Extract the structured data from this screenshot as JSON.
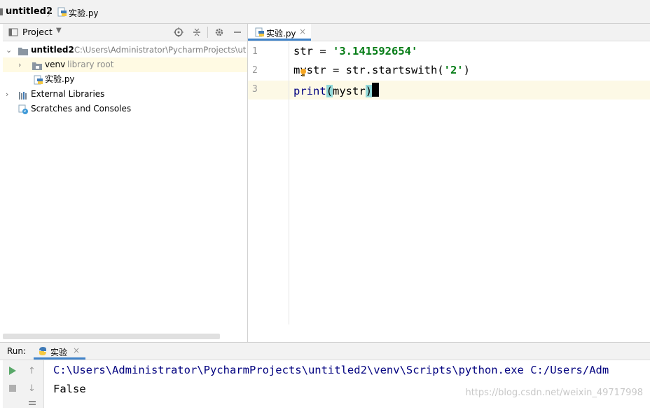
{
  "breadcrumb": {
    "project": "untitled2",
    "separator": "〉",
    "file": "实验.py"
  },
  "project_panel": {
    "title": "Project",
    "tree": [
      {
        "label": "untitled2",
        "sub": "C:\\Users\\Administrator\\PycharmProjects\\ut",
        "bold": true
      },
      {
        "label": "venv",
        "sub": "library root"
      },
      {
        "label": "实验.py",
        "sub": ""
      },
      {
        "label": "External Libraries",
        "sub": ""
      },
      {
        "label": "Scratches and Consoles",
        "sub": ""
      }
    ]
  },
  "editor": {
    "tab_label": "实验.py",
    "tab_close": "×",
    "line_numbers": [
      "1",
      "2",
      "3"
    ],
    "lines": {
      "l1_a": "str = ",
      "l1_str": "'3.141592654'",
      "l2_a": "mystr = str.startswith(",
      "l2_str": "'2'",
      "l2_b": ")",
      "l3_fn": "print",
      "l3_open": "(",
      "l3_arg": "mystr",
      "l3_close": ")"
    }
  },
  "run": {
    "label": "Run:",
    "tab_label": "实验",
    "tab_close": "×",
    "output": [
      "C:\\Users\\Administrator\\PycharmProjects\\untitled2\\venv\\Scripts\\python.exe C:/Users/Adm",
      "False"
    ],
    "watermark": "https://blog.csdn.net/weixin_49717998"
  },
  "colors": {
    "string": "#067d17",
    "accent": "#4083c9",
    "builtin": "#000080",
    "brace_highlight": "#93d9d9"
  }
}
